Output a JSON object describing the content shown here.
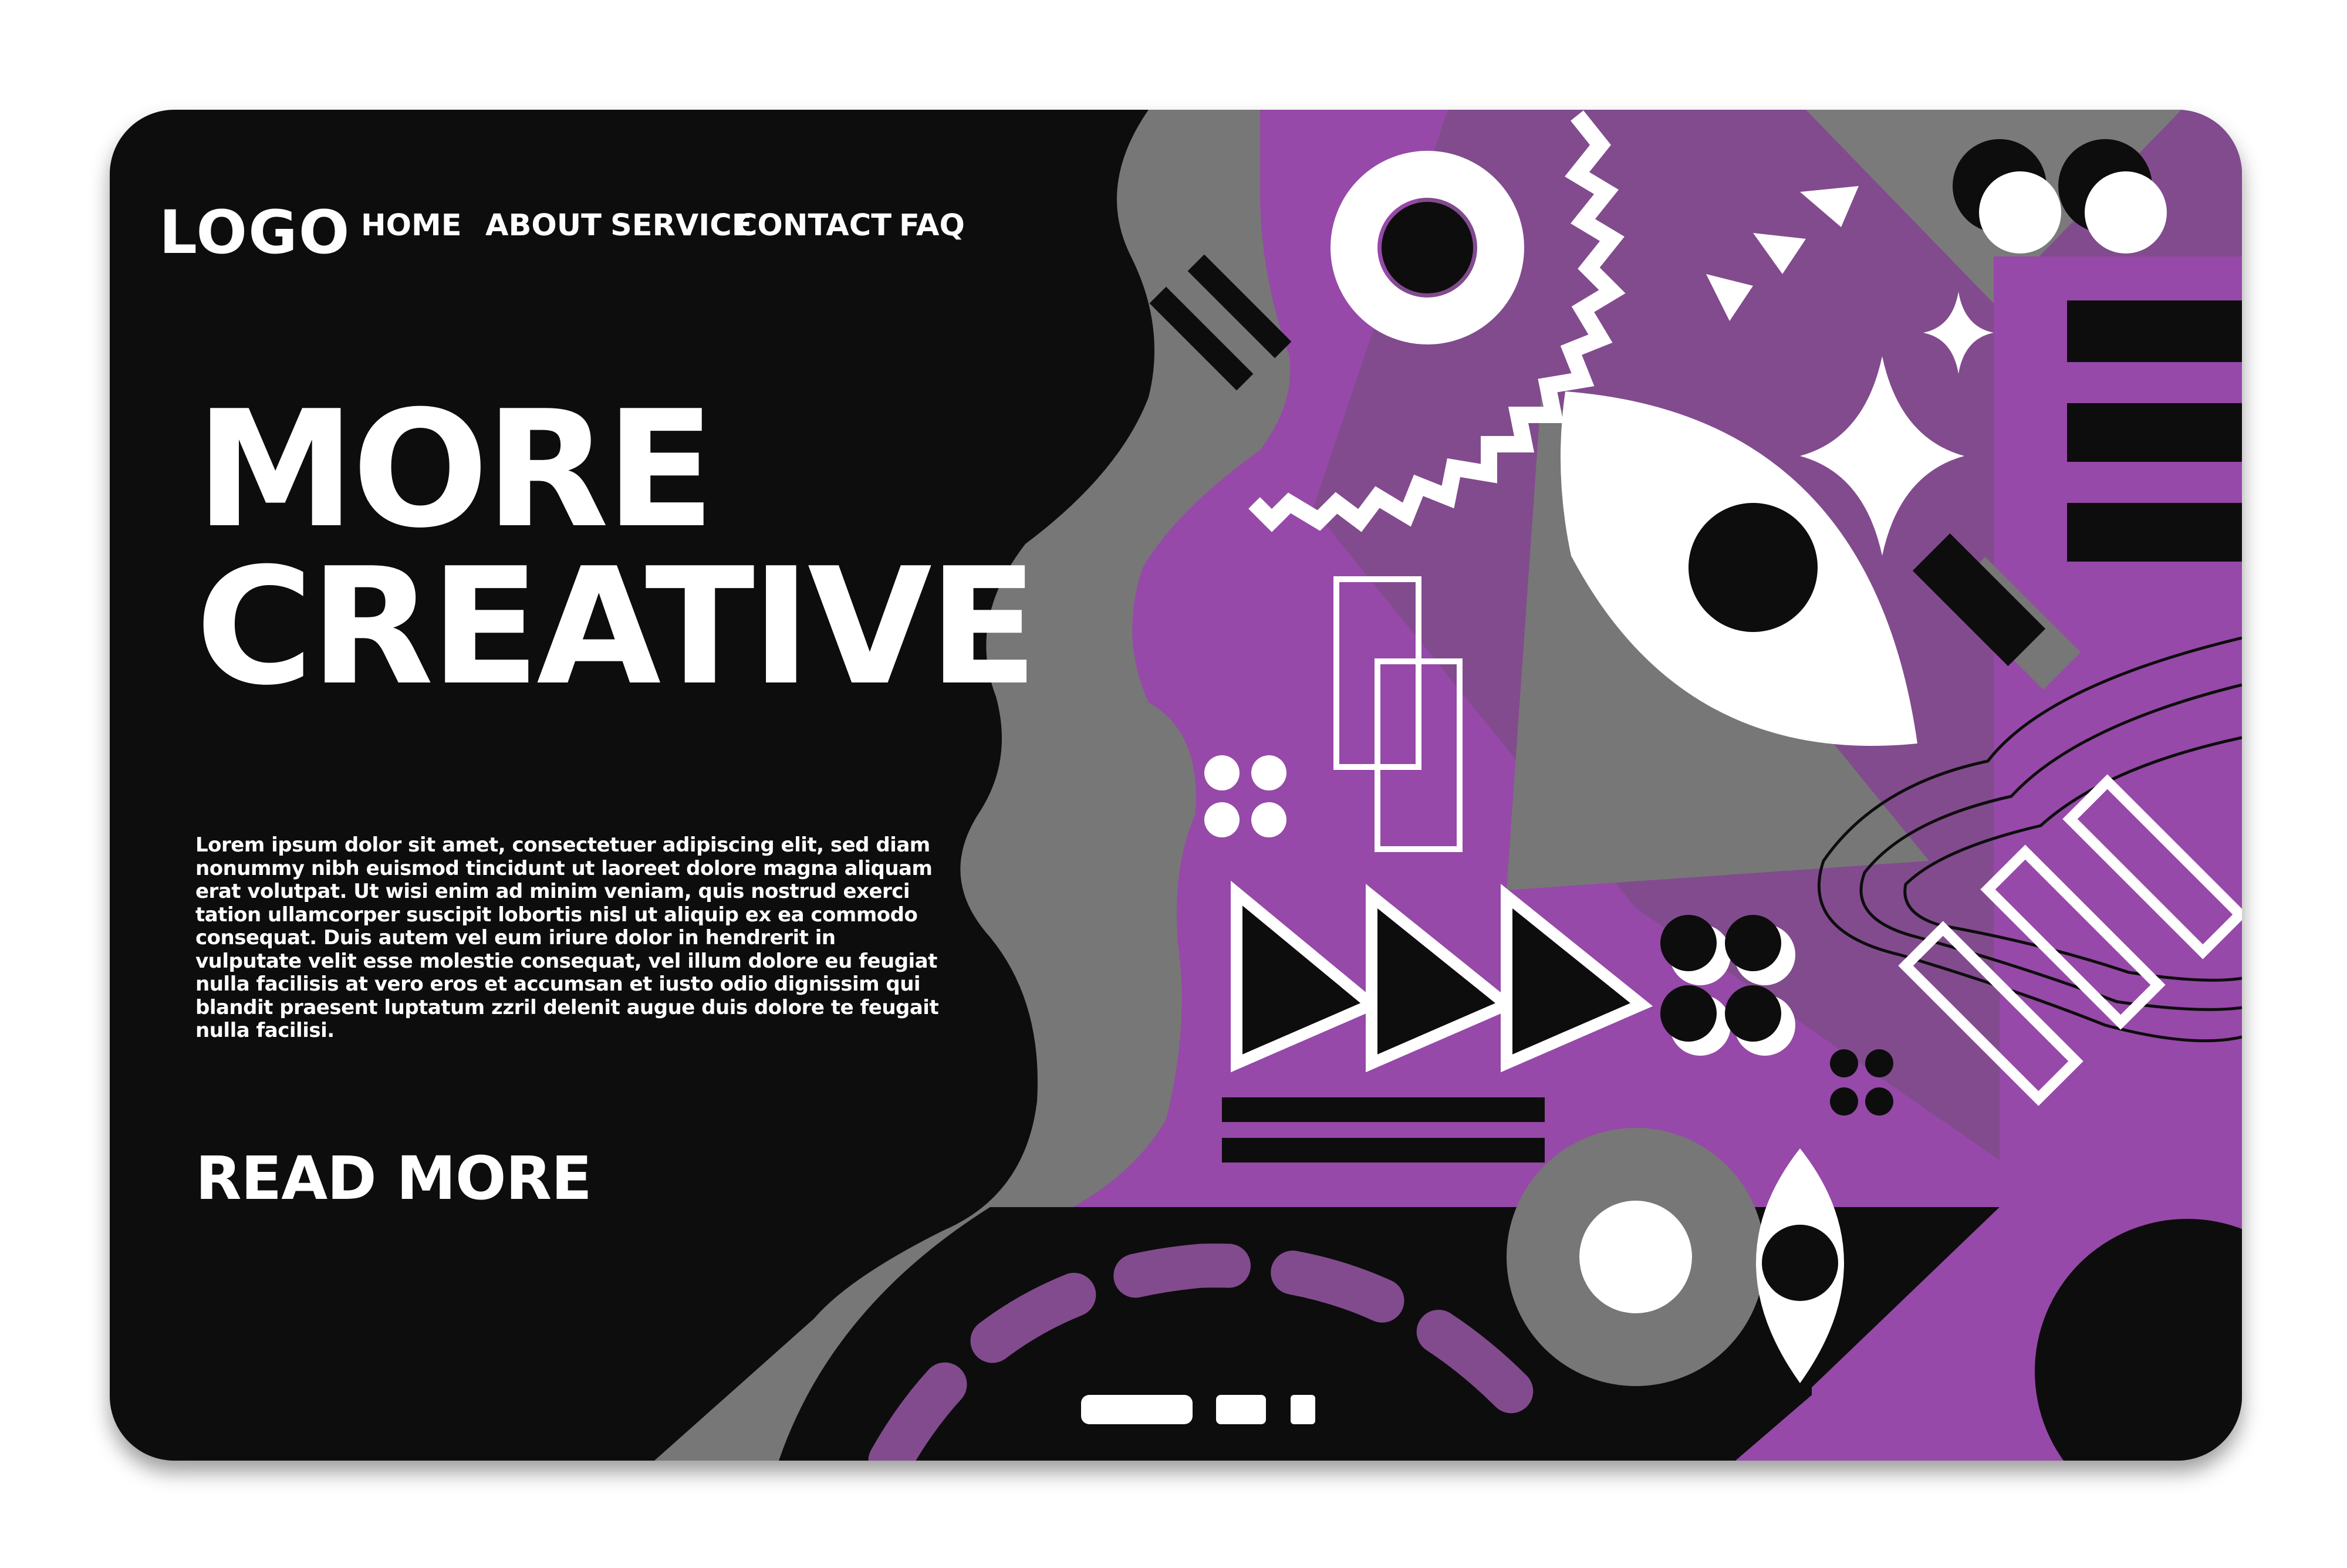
{
  "header": {
    "logo": "LOGO",
    "nav": [
      {
        "label": "HOME"
      },
      {
        "label": "ABOUT"
      },
      {
        "label": "SERVICE"
      },
      {
        "label": "CONTACT"
      },
      {
        "label": "FAQ"
      }
    ]
  },
  "hero": {
    "title_line1": "MORE",
    "title_line2": "CREATIVE",
    "body": "Lorem ipsum dolor sit amet, consectetuer adipiscing elit, sed diam nonummy nibh euismod tincidunt ut laoreet dolore magna aliquam erat volutpat. Ut wisi enim ad minim veniam, quis nostrud exerci tation ullamcorper suscipit lobortis nisl ut aliquip ex ea commodo consequat. Duis autem vel eum iriure dolor in hendrerit in vulputate velit esse molestie consequat, vel illum dolore eu feugiat nulla facilisis at vero eros et accumsan et iusto odio dignissim qui blandit praesent luptatum zzril delenit augue duis dolore te feugait nulla facilisi.",
    "cta": "READ MORE"
  },
  "colors": {
    "background": "#0d0d0d",
    "purple": "#9649a8",
    "dark_purple": "#824b8e",
    "gray": "#777777",
    "white": "#ffffff"
  }
}
